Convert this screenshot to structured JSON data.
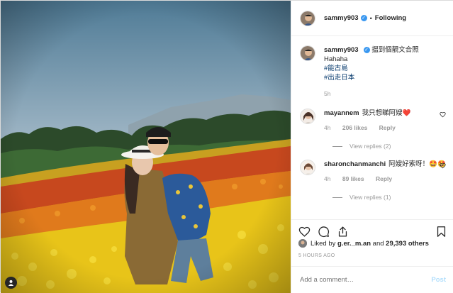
{
  "post": {
    "username": "sammy903",
    "follow_label": "Following",
    "caption_text": "搵到個靚文合照",
    "caption_line2": "Hahaha",
    "hashtags": [
      "#能古島",
      "#出走日本"
    ],
    "caption_time": "5h"
  },
  "comments": [
    {
      "username": "mayannem",
      "text": "我只想睇阿嫂❤️",
      "time": "4h",
      "likes": "206 likes",
      "reply_label": "Reply",
      "view_replies": "View replies (2)"
    },
    {
      "username": "sharonchanmanchi",
      "text": "阿嫂好索呀！🤩🤩",
      "time": "4h",
      "likes": "89 likes",
      "reply_label": "Reply",
      "view_replies": "View replies (1)"
    }
  ],
  "likes": {
    "prefix": "Liked by",
    "user": "g.er._m.an",
    "conj": "and",
    "count": "29,393 others"
  },
  "timestamp": "5 HOURS AGO",
  "add_comment": {
    "placeholder": "Add a comment…",
    "post_label": "Post"
  },
  "icons": {
    "verified": "verified-badge-icon",
    "like": "heart-icon",
    "comment": "comment-bubble-icon",
    "share": "share-icon",
    "save": "bookmark-icon",
    "tag": "person-tag-icon"
  },
  "colors": {
    "verified_blue": "#3897f0",
    "link": "#003569",
    "post_disabled": "#b2dffc"
  }
}
